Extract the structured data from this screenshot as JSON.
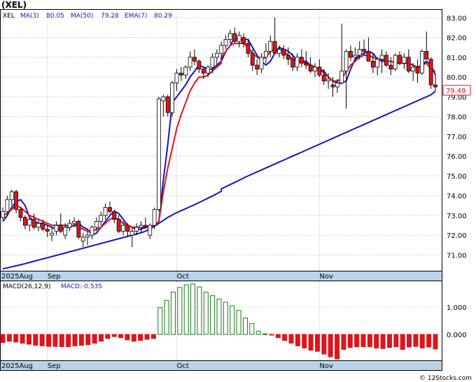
{
  "header": {
    "ticker_title": "(XEL)",
    "legend": {
      "symbol": "XEL",
      "ma3_label": "MA(3)",
      "ma3_value": "80.05",
      "ma50_label": "MA(50)",
      "ma50_value": "79.28",
      "ema7_label": "EMA(7)",
      "ema7_value": "80.29"
    },
    "last_price_tag": "79.49",
    "macd_legend": {
      "params": "MACD(26,12,9)",
      "value": "MACD:-0.535"
    },
    "watermark": "© 12Stocks.com"
  },
  "colors": {
    "up_candle": "#ffffff",
    "down_candle": "#e0141c",
    "candle_outline": "#000000",
    "wick": "#000000",
    "ma_short": "#1414c8",
    "ma50": "#1414c8",
    "ema7": "#e0141c",
    "macd_pos": "#1a7a1a",
    "macd_neg": "#e0141c",
    "axis_band": "#b9d3ea",
    "price_tag_border": "#e0141c"
  },
  "chart_data": [
    {
      "type": "candlestick",
      "title": "(XEL)",
      "y_ticks": [
        71,
        72,
        73,
        74,
        75,
        76,
        77,
        78,
        79,
        80,
        81,
        82,
        83
      ],
      "y_tick_labels": [
        "71.00",
        "72.00",
        "73.00",
        "74.00",
        "75.00",
        "76.00",
        "77.00",
        "78.00",
        "79.00",
        "80.00",
        "81.00",
        "82.00",
        "83.00"
      ],
      "ylim": [
        70.2,
        83.4
      ],
      "x_labels": [
        {
          "label": "2025Aug",
          "bar_index": 0
        },
        {
          "label": "Sep",
          "bar_index": 10
        },
        {
          "label": "Oct",
          "bar_index": 39
        },
        {
          "label": "Nov",
          "bar_index": 71
        }
      ],
      "grid": true,
      "candles": [
        [
          72.9,
          73.4,
          72.8,
          73.2
        ],
        [
          73.2,
          74.0,
          73.0,
          73.8
        ],
        [
          73.8,
          74.3,
          73.5,
          74.2
        ],
        [
          74.2,
          74.3,
          73.1,
          73.3
        ],
        [
          73.3,
          73.4,
          72.7,
          72.9
        ],
        [
          72.9,
          73.0,
          72.3,
          72.5
        ],
        [
          72.5,
          72.9,
          72.2,
          72.8
        ],
        [
          72.8,
          73.1,
          72.3,
          72.4
        ],
        [
          72.4,
          72.8,
          72.2,
          72.6
        ],
        [
          72.6,
          72.8,
          72.2,
          72.3
        ],
        [
          72.3,
          72.5,
          71.9,
          72.2
        ],
        [
          72.0,
          72.4,
          71.7,
          72.1
        ],
        [
          72.2,
          72.7,
          72.0,
          72.5
        ],
        [
          72.5,
          73.1,
          72.1,
          72.2
        ],
        [
          72.0,
          72.6,
          71.8,
          72.4
        ],
        [
          72.4,
          72.8,
          72.2,
          72.6
        ],
        [
          72.6,
          72.9,
          72.4,
          72.7
        ],
        [
          72.7,
          72.8,
          71.8,
          71.9
        ],
        [
          71.7,
          72.1,
          71.4,
          71.9
        ],
        [
          71.9,
          72.2,
          71.5,
          72.0
        ],
        [
          72.0,
          72.5,
          71.8,
          72.4
        ],
        [
          72.4,
          72.9,
          72.2,
          72.7
        ],
        [
          72.7,
          73.2,
          72.5,
          73.0
        ],
        [
          73.0,
          73.6,
          72.8,
          73.4
        ],
        [
          73.4,
          73.7,
          73.1,
          73.2
        ],
        [
          73.2,
          73.3,
          72.6,
          72.8
        ],
        [
          72.8,
          73.0,
          72.1,
          72.2
        ],
        [
          72.2,
          72.7,
          72.0,
          72.5
        ],
        [
          72.5,
          72.6,
          71.9,
          72.2
        ],
        [
          72.0,
          72.4,
          71.4,
          72.2
        ],
        [
          72.2,
          72.6,
          72.0,
          72.4
        ],
        [
          72.4,
          72.7,
          72.1,
          72.5
        ],
        [
          72.5,
          72.9,
          72.3,
          72.4
        ],
        [
          72.0,
          72.6,
          71.8,
          72.5
        ],
        [
          72.5,
          73.4,
          72.3,
          73.3
        ],
        [
          73.3,
          79.0,
          73.2,
          78.9
        ],
        [
          78.8,
          79.1,
          78.0,
          79.0
        ],
        [
          79.0,
          79.1,
          78.0,
          78.2
        ],
        [
          78.2,
          79.8,
          78.0,
          79.7
        ],
        [
          79.7,
          80.4,
          79.3,
          80.2
        ],
        [
          80.2,
          80.5,
          79.8,
          80.1
        ],
        [
          80.1,
          80.6,
          79.9,
          80.5
        ],
        [
          80.5,
          81.3,
          80.3,
          81.0
        ],
        [
          81.0,
          81.4,
          80.6,
          80.8
        ],
        [
          80.8,
          80.9,
          80.2,
          80.4
        ],
        [
          80.4,
          80.5,
          79.9,
          80.2
        ],
        [
          80.2,
          80.6,
          80.0,
          80.5
        ],
        [
          80.5,
          81.2,
          80.2,
          81.0
        ],
        [
          81.0,
          81.4,
          80.6,
          81.2
        ],
        [
          81.2,
          81.8,
          80.9,
          81.6
        ],
        [
          81.6,
          82.1,
          81.4,
          81.9
        ],
        [
          81.9,
          82.4,
          81.7,
          82.2
        ],
        [
          82.2,
          82.5,
          81.7,
          81.8
        ],
        [
          81.8,
          82.3,
          81.5,
          82.1
        ],
        [
          82.0,
          82.2,
          81.5,
          81.7
        ],
        [
          81.7,
          81.9,
          81.0,
          81.2
        ],
        [
          81.2,
          81.4,
          80.3,
          80.6
        ],
        [
          80.6,
          80.9,
          80.1,
          80.4
        ],
        [
          80.4,
          81.2,
          80.2,
          81.0
        ],
        [
          81.0,
          81.7,
          80.7,
          81.3
        ],
        [
          81.3,
          82.1,
          81.0,
          81.8
        ],
        [
          81.8,
          83.0,
          81.4,
          81.2
        ],
        [
          81.2,
          81.6,
          81.0,
          81.4
        ],
        [
          81.4,
          81.6,
          80.9,
          81.1
        ],
        [
          81.1,
          81.5,
          80.6,
          80.9
        ],
        [
          80.9,
          81.2,
          80.3,
          80.5
        ],
        [
          80.5,
          81.2,
          80.3,
          81.0
        ],
        [
          81.0,
          81.4,
          80.5,
          80.7
        ],
        [
          80.7,
          81.3,
          80.4,
          80.6
        ],
        [
          80.6,
          81.0,
          80.2,
          80.3
        ],
        [
          80.3,
          80.7,
          80.0,
          80.5
        ],
        [
          80.5,
          80.9,
          80.0,
          80.1
        ],
        [
          80.1,
          80.4,
          79.6,
          79.8
        ],
        [
          79.8,
          80.2,
          79.4,
          79.9
        ],
        [
          79.6,
          80.0,
          79.0,
          79.5
        ],
        [
          79.5,
          79.9,
          79.2,
          79.7
        ],
        [
          79.7,
          82.7,
          79.6,
          80.3
        ],
        [
          80.3,
          81.4,
          78.4,
          81.3
        ],
        [
          81.3,
          81.6,
          80.8,
          81.0
        ],
        [
          81.0,
          81.5,
          80.8,
          81.1
        ],
        [
          81.1,
          81.8,
          80.9,
          81.4
        ],
        [
          81.4,
          81.9,
          81.1,
          81.3
        ],
        [
          81.3,
          82.0,
          80.9,
          80.8
        ],
        [
          80.8,
          81.2,
          80.2,
          80.5
        ],
        [
          80.5,
          81.0,
          80.1,
          80.9
        ],
        [
          80.9,
          81.4,
          80.2,
          81.1
        ],
        [
          81.1,
          81.3,
          80.5,
          80.6
        ],
        [
          80.6,
          81.0,
          80.1,
          80.4
        ],
        [
          80.4,
          81.2,
          80.3,
          81.1
        ],
        [
          81.1,
          81.3,
          80.6,
          80.7
        ],
        [
          80.7,
          81.2,
          80.4,
          81.0
        ],
        [
          81.0,
          81.4,
          80.2,
          80.3
        ],
        [
          80.3,
          80.7,
          79.8,
          80.5
        ],
        [
          80.5,
          80.9,
          79.7,
          80.2
        ],
        [
          80.2,
          81.4,
          80.1,
          81.3
        ],
        [
          81.3,
          82.3,
          81.1,
          80.9
        ],
        [
          80.9,
          81.0,
          79.4,
          79.6
        ],
        [
          79.6,
          80.1,
          79.3,
          79.5
        ]
      ],
      "series": [
        {
          "name": "MA(3)",
          "values": [
            72.7,
            73.0,
            73.4,
            73.7,
            73.8,
            73.5,
            72.9,
            72.7,
            72.6,
            72.6,
            72.5,
            72.4,
            72.3,
            72.3,
            72.4,
            72.4,
            72.5,
            72.6,
            72.4,
            72.3,
            72.0,
            72.1,
            72.4,
            72.7,
            73.0,
            73.2,
            73.1,
            72.8,
            72.5,
            72.4,
            72.3,
            72.3,
            72.4,
            72.4,
            72.5,
            72.7,
            74.8,
            76.6,
            78.7,
            79.0,
            79.3,
            79.6,
            80.0,
            80.3,
            80.6,
            80.5,
            80.4,
            80.4,
            80.6,
            80.8,
            81.3,
            81.6,
            82.0,
            81.9,
            81.9,
            81.9,
            81.5,
            81.1,
            80.8,
            80.6,
            80.8,
            81.2,
            81.5,
            81.4,
            81.3,
            81.1,
            80.8,
            80.8,
            80.8,
            80.6,
            80.5,
            80.4,
            80.3,
            80.0,
            79.8,
            79.7,
            79.7,
            79.8,
            80.4,
            80.9,
            81.1,
            81.2,
            81.3,
            81.2,
            80.9,
            80.8,
            80.8,
            80.8,
            80.7,
            80.7,
            80.7,
            80.7,
            80.6,
            80.5,
            80.6,
            80.8,
            80.6,
            80.1
          ]
        },
        {
          "name": "MA(50)",
          "values": [
            70.3,
            70.35,
            70.4,
            70.45,
            70.5,
            70.56,
            70.62,
            70.68,
            70.74,
            70.8,
            70.86,
            70.92,
            70.98,
            71.04,
            71.1,
            71.16,
            71.22,
            71.28,
            71.34,
            71.4,
            71.46,
            71.52,
            71.58,
            71.64,
            71.7,
            71.76,
            71.82,
            71.88,
            71.94,
            72.0,
            72.06,
            72.12,
            72.2,
            72.32,
            72.45,
            72.6,
            72.75,
            72.9,
            73.02,
            73.14,
            73.24,
            73.34,
            73.44,
            73.54,
            73.65,
            73.76,
            73.87,
            73.98,
            74.1,
            74.22,
            74.34,
            74.45,
            74.56,
            74.67,
            74.78,
            74.89,
            75.0,
            75.1,
            75.2,
            75.3,
            75.4,
            75.5,
            75.6,
            75.7,
            75.8,
            75.9,
            76.0,
            76.1,
            76.2,
            76.3,
            76.4,
            76.5,
            76.6,
            76.7,
            76.8,
            76.9,
            77.0,
            77.1,
            77.2,
            77.3,
            77.4,
            77.5,
            77.6,
            77.7,
            77.8,
            77.9,
            78.0,
            78.1,
            78.2,
            78.3,
            78.4,
            78.5,
            78.6,
            78.7,
            78.8,
            78.9,
            79.0,
            79.1,
            79.28
          ]
        },
        {
          "name": "EMA(7)",
          "values": [
            73.0,
            73.1,
            73.3,
            73.5,
            73.4,
            73.2,
            73.0,
            72.9,
            72.8,
            72.7,
            72.6,
            72.5,
            72.5,
            72.5,
            72.5,
            72.5,
            72.5,
            72.4,
            72.3,
            72.2,
            72.2,
            72.3,
            72.4,
            72.6,
            72.8,
            72.9,
            72.8,
            72.6,
            72.5,
            72.4,
            72.4,
            72.4,
            72.4,
            72.4,
            72.5,
            72.7,
            74.2,
            75.4,
            76.4,
            77.4,
            78.1,
            78.7,
            79.3,
            79.7,
            80.0,
            80.0,
            80.1,
            80.3,
            80.5,
            80.7,
            81.0,
            81.3,
            81.6,
            81.7,
            81.7,
            81.7,
            81.5,
            81.2,
            81.0,
            80.9,
            81.0,
            81.3,
            81.4,
            81.4,
            81.3,
            81.1,
            80.9,
            80.8,
            80.8,
            80.7,
            80.6,
            80.5,
            80.4,
            80.2,
            80.0,
            79.8,
            79.8,
            79.9,
            80.3,
            80.6,
            80.8,
            81.0,
            81.1,
            81.1,
            81.0,
            80.9,
            80.9,
            80.8,
            80.8,
            80.7,
            80.7,
            80.7,
            80.7,
            80.6,
            80.5,
            80.6,
            80.7,
            80.4,
            80.29
          ]
        }
      ]
    },
    {
      "type": "bar",
      "title": "MACD(26,12,9)",
      "y_ticks": [
        0,
        1
      ],
      "y_tick_labels": [
        "0.000",
        "1.000"
      ],
      "ylim": [
        -0.95,
        1.95
      ],
      "x_labels": [
        {
          "label": "2025Aug",
          "bar_index": 0
        },
        {
          "label": "Sep",
          "bar_index": 10
        },
        {
          "label": "Oct",
          "bar_index": 39
        },
        {
          "label": "Nov",
          "bar_index": 71
        }
      ],
      "series": [
        {
          "name": "MACD",
          "values": [
            -0.3,
            -0.25,
            -0.28,
            -0.32,
            -0.36,
            -0.4,
            -0.42,
            -0.44,
            -0.44,
            -0.45,
            -0.45,
            -0.42,
            -0.4,
            -0.38,
            -0.32,
            -0.25,
            -0.15,
            -0.08,
            -0.12,
            -0.2,
            -0.25,
            -0.22,
            -0.18,
            -0.15,
            0.98,
            1.25,
            1.55,
            1.72,
            1.82,
            1.85,
            1.74,
            1.55,
            1.42,
            1.3,
            1.18,
            1.05,
            0.88,
            0.6,
            0.4,
            0.12,
            0.02,
            -0.02,
            -0.12,
            -0.22,
            -0.32,
            -0.42,
            -0.5,
            -0.58,
            -0.62,
            -0.72,
            -0.82,
            -0.9,
            -0.55,
            -0.48,
            -0.45,
            -0.45,
            -0.45,
            -0.5,
            -0.52,
            -0.48,
            -0.45,
            -0.55,
            -0.46,
            -0.44,
            -0.5,
            -0.46,
            -0.535
          ]
        }
      ]
    }
  ]
}
